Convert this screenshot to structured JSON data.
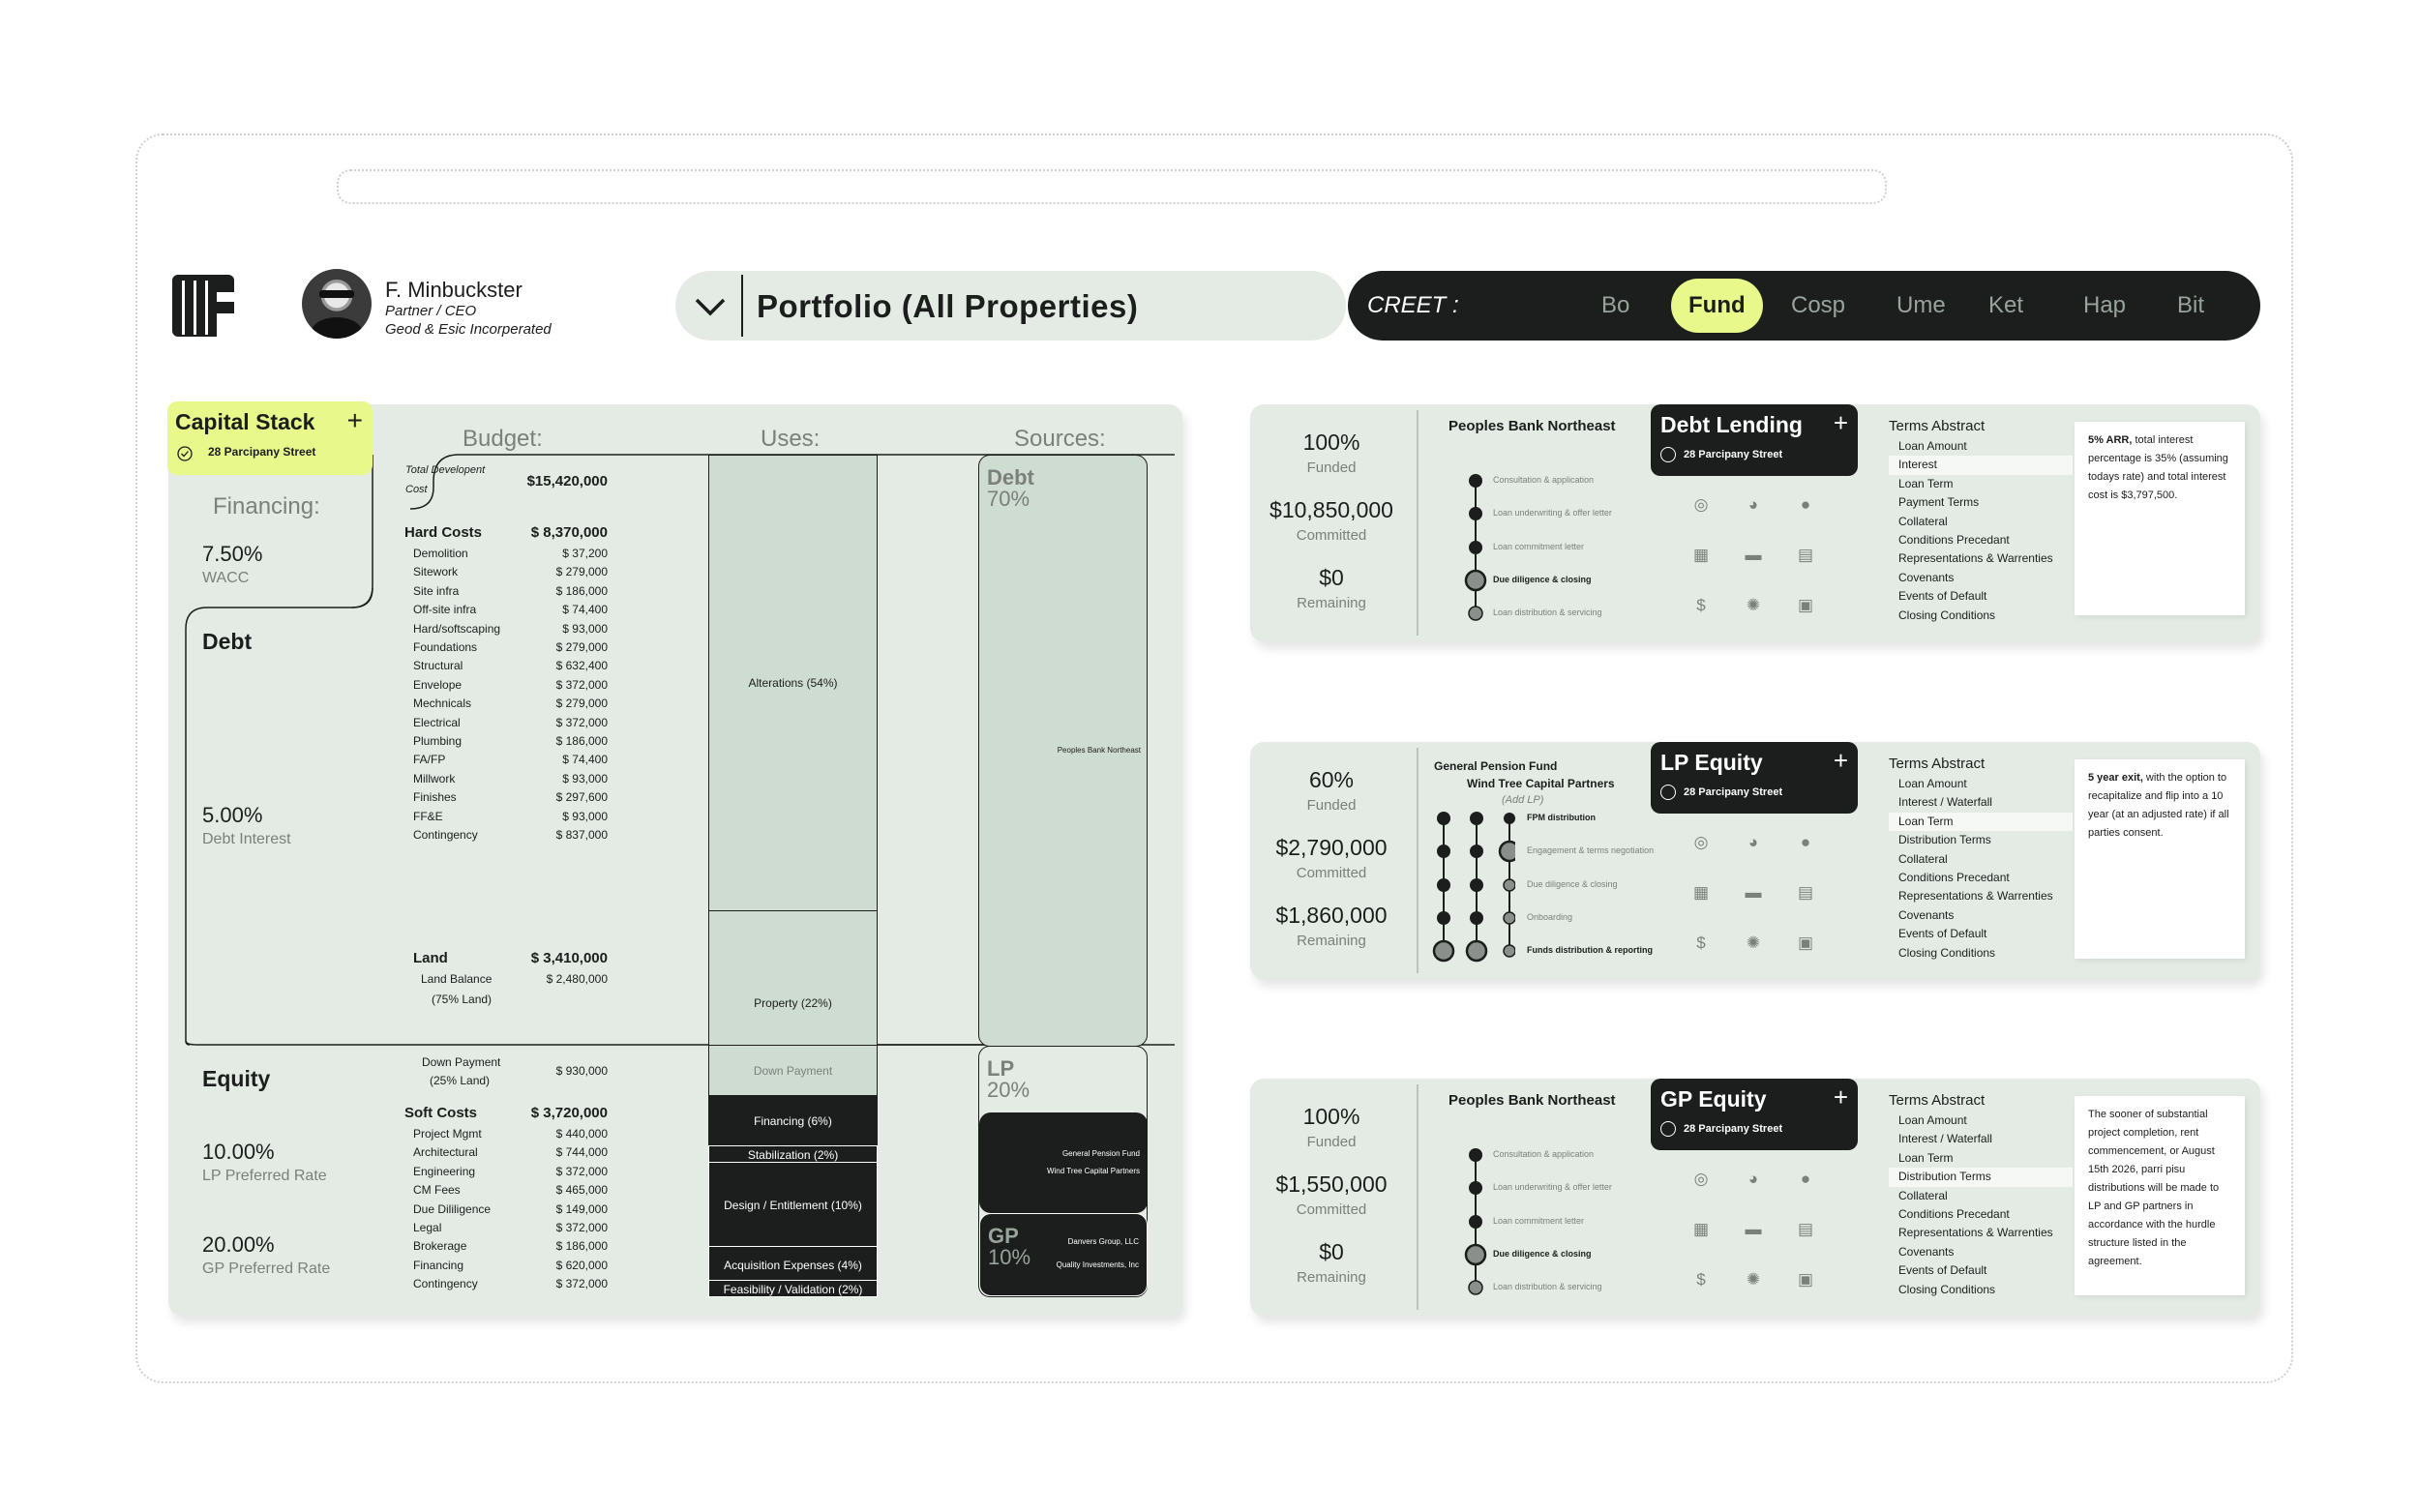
{
  "header": {
    "user_name": "F. Minbuckster",
    "user_role": "Partner / CEO",
    "user_company": "Geod & Esic Incorperated",
    "portfolio_title": "Portfolio (All Properties)",
    "nav_label": "CREET :",
    "nav_items": [
      "Bo",
      "Fund",
      "Cosp",
      "Ume",
      "Ket",
      "Hap",
      "Bit"
    ],
    "nav_active": "Fund"
  },
  "colors": {
    "accent": "#e8f88a",
    "dark": "#1c1e1d",
    "panel": "#e3ebe4",
    "muted": "#7b807c"
  },
  "capital_stack": {
    "title": "Capital Stack",
    "plus": "+",
    "address": "28 Parcipany Street",
    "budget_header": "Budget:",
    "uses_header": "Uses:",
    "sources_header": "Sources:",
    "financing_header": "Financing:",
    "wacc_value": "7.50%",
    "wacc_label": "WACC",
    "debt_label": "Debt",
    "debt_interest_value": "5.00%",
    "debt_interest_label": "Debt Interest",
    "equity_label": "Equity",
    "lp_rate_value": "10.00%",
    "lp_rate_label": "LP Preferred Rate",
    "gp_rate_value": "20.00%",
    "gp_rate_label": "GP Preferred Rate",
    "total_label_1": "Total Developent",
    "total_label_2": "Cost",
    "total_value": "$15,420,000",
    "hard_costs_label": "Hard Costs",
    "hard_costs_value": "$ 8,370,000",
    "hard_costs": [
      {
        "label": "Demolition",
        "value": "$ 37,200"
      },
      {
        "label": "Sitework",
        "value": "$ 279,000"
      },
      {
        "label": "Site infra",
        "value": "$ 186,000"
      },
      {
        "label": "Off-site infra",
        "value": "$ 74,400"
      },
      {
        "label": "Hard/softscaping",
        "value": "$ 93,000"
      },
      {
        "label": "Foundations",
        "value": "$ 279,000"
      },
      {
        "label": "Structural",
        "value": "$ 632,400"
      },
      {
        "label": "Envelope",
        "value": "$ 372,000"
      },
      {
        "label": "Mechnicals",
        "value": "$ 279,000"
      },
      {
        "label": "Electrical",
        "value": "$ 372,000"
      },
      {
        "label": "Plumbing",
        "value": "$ 186,000"
      },
      {
        "label": "FA/FP",
        "value": "$ 74,400"
      },
      {
        "label": "Millwork",
        "value": "$ 93,000"
      },
      {
        "label": "Finishes",
        "value": "$ 297,600"
      },
      {
        "label": "FF&E",
        "value": "$ 93,000"
      },
      {
        "label": "Contingency",
        "value": "$ 837,000"
      }
    ],
    "land_label": "Land",
    "land_value": "$ 3,410,000",
    "land_balance_label": "Land Balance",
    "land_balance_value": "$ 2,480,000",
    "land_balance_note": "(75% Land)",
    "down_payment_label": "Down Payment",
    "down_payment_note": "(25% Land)",
    "down_payment_value": "$ 930,000",
    "soft_costs_label": "Soft Costs",
    "soft_costs_value": "$ 3,720,000",
    "soft_costs": [
      {
        "label": "Project Mgmt",
        "value": "$ 440,000"
      },
      {
        "label": "Architectural",
        "value": "$ 744,000"
      },
      {
        "label": "Engineering",
        "value": "$ 372,000"
      },
      {
        "label": "CM Fees",
        "value": "$ 465,000"
      },
      {
        "label": "Due Dililigence",
        "value": "$ 149,000"
      },
      {
        "label": "Legal",
        "value": "$ 372,000"
      },
      {
        "label": "Brokerage",
        "value": "$ 186,000"
      },
      {
        "label": "Financing",
        "value": "$ 620,000"
      },
      {
        "label": "Contingency",
        "value": "$ 372,000"
      }
    ],
    "uses": {
      "alterations": "Alterations (54%)",
      "property": "Property (22%)",
      "down_payment": "Down Payment",
      "financing": "Financing (6%)",
      "stabilization": "Stabilization (2%)",
      "design": "Design / Entitlement (10%)",
      "acquisition": "Acquisition Expenses (4%)",
      "feasibility": "Feasibility / Validation (2%)"
    },
    "sources": {
      "debt_label": "Debt",
      "debt_pct": "70%",
      "debt_lender": "Peoples Bank Northeast",
      "lp_label": "LP",
      "lp_pct": "20%",
      "lp_investor_1": "General Pension Fund",
      "lp_investor_2": "Wind Tree Capital Partners",
      "gp_label": "GP",
      "gp_pct": "10%",
      "gp_investor_1": "Danvers Group, LLC",
      "gp_investor_2": "Quality Investments, Inc"
    }
  },
  "cards": [
    {
      "funded_value": "100%",
      "funded_label": "Funded",
      "committed_value": "$10,850,000",
      "committed_label": "Committed",
      "remaining_value": "$0",
      "remaining_label": "Remaining",
      "party": "Peoples Bank Northeast",
      "tag_title": "Debt Lending",
      "tag_plus": "+",
      "tag_address": "28 Parcipany Street",
      "steps": [
        "Consultation & application",
        "Loan underwriting & offer letter",
        "Loan commitment letter",
        "Due diligence & closing",
        "Loan distribution & servicing"
      ],
      "terms_header": "Terms Abstract",
      "terms": [
        "Loan Amount",
        "Interest",
        "Loan Term",
        "Payment Terms",
        "Collateral",
        "Conditions Precedant",
        "Representations & Warrenties",
        "Covenants",
        "Events of Default",
        "Closing Conditions"
      ],
      "note_bold": "5% ARR,",
      "note_text": " total interest percentage is 35% (assuming todays rate) and total interest cost is $3,797,500."
    },
    {
      "funded_value": "60%",
      "funded_label": "Funded",
      "committed_value": "$2,790,000",
      "committed_label": "Committed",
      "remaining_value": "$1,860,000",
      "remaining_label": "Remaining",
      "party": "General Pension Fund",
      "party_2": "Wind Tree Capital Partners",
      "add_lp": "(Add LP)",
      "tag_title": "LP Equity",
      "tag_plus": "+",
      "tag_address": "28 Parcipany Street",
      "steps": [
        "FPM distribution",
        "Engagement & terms negotiation",
        "Due diligence & closing",
        "Onboarding",
        "Funds distribution & reporting"
      ],
      "terms_header": "Terms Abstract",
      "terms": [
        "Loan Amount",
        "Interest / Waterfall",
        "Loan Term",
        "Distribution Terms",
        "Collateral",
        "Conditions Precedant",
        "Representations & Warrenties",
        "Covenants",
        "Events of Default",
        "Closing Conditions"
      ],
      "note_bold": "5 year exit,",
      "note_text": " with the option to recapitalize and flip into a 10 year (at an adjusted rate) if all parties consent."
    },
    {
      "funded_value": "100%",
      "funded_label": "Funded",
      "committed_value": "$1,550,000",
      "committed_label": "Committed",
      "remaining_value": "$0",
      "remaining_label": "Remaining",
      "party": "Peoples Bank Northeast",
      "tag_title": "GP Equity",
      "tag_plus": "+",
      "tag_address": "28 Parcipany Street",
      "steps": [
        "Consultation & application",
        "Loan underwriting & offer letter",
        "Loan commitment letter",
        "Due diligence & closing",
        "Loan distribution & servicing"
      ],
      "terms_header": "Terms Abstract",
      "terms": [
        "Loan Amount",
        "Interest / Waterfall",
        "Loan Term",
        "Distribution Terms",
        "Collateral",
        "Conditions Precedant",
        "Representations & Warrenties",
        "Covenants",
        "Events of Default",
        "Closing Conditions"
      ],
      "note_bold": "",
      "note_text": "The sooner of substantial project completion, rent commencement, or August 15th 2026, parri pisu distributions will be made to LP and GP partners in accordance with the hurdle structure listed in the agreement."
    }
  ]
}
